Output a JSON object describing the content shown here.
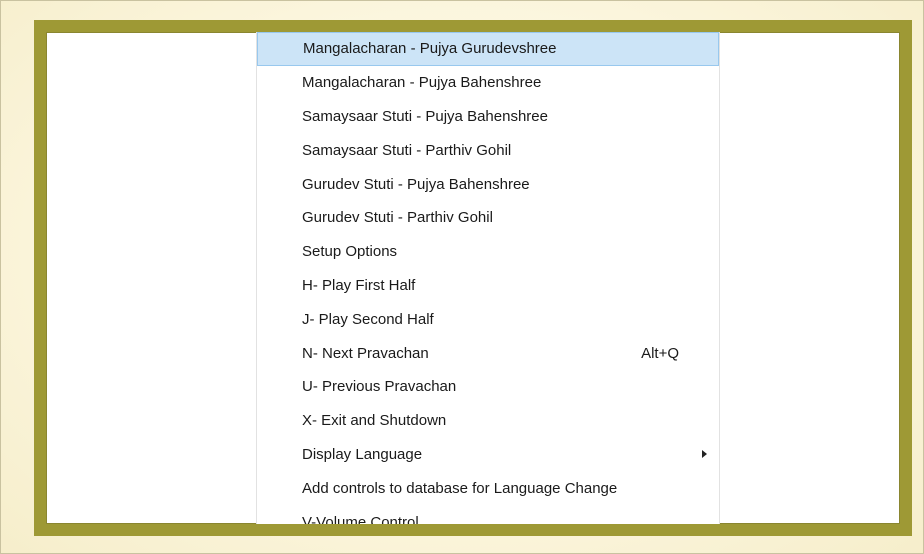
{
  "menu": {
    "items": [
      {
        "label": "Mangalacharan - Pujya Gurudevshree",
        "selected": true
      },
      {
        "label": "Mangalacharan - Pujya Bahenshree"
      },
      {
        "label": "Samaysaar Stuti - Pujya Bahenshree"
      },
      {
        "label": "Samaysaar Stuti - Parthiv Gohil"
      },
      {
        "label": "Gurudev Stuti - Pujya Bahenshree"
      },
      {
        "label": "Gurudev Stuti - Parthiv Gohil"
      },
      {
        "label": "Setup Options"
      },
      {
        "label": "H- Play First Half"
      },
      {
        "label": "J- Play Second Half"
      },
      {
        "label": "N- Next Pravachan",
        "shortcut": "Alt+Q"
      },
      {
        "label": "U- Previous Pravachan"
      },
      {
        "label": "X- Exit and Shutdown"
      },
      {
        "label": "Display Language",
        "submenu": true
      },
      {
        "label": "Add controls to database for Language Change"
      },
      {
        "label": "V-Volume Control"
      }
    ]
  },
  "colors": {
    "frame": "#9e9935",
    "background": "#fdf8e3",
    "highlight": "#cce4f7",
    "highlight_border": "#98c8ee"
  }
}
